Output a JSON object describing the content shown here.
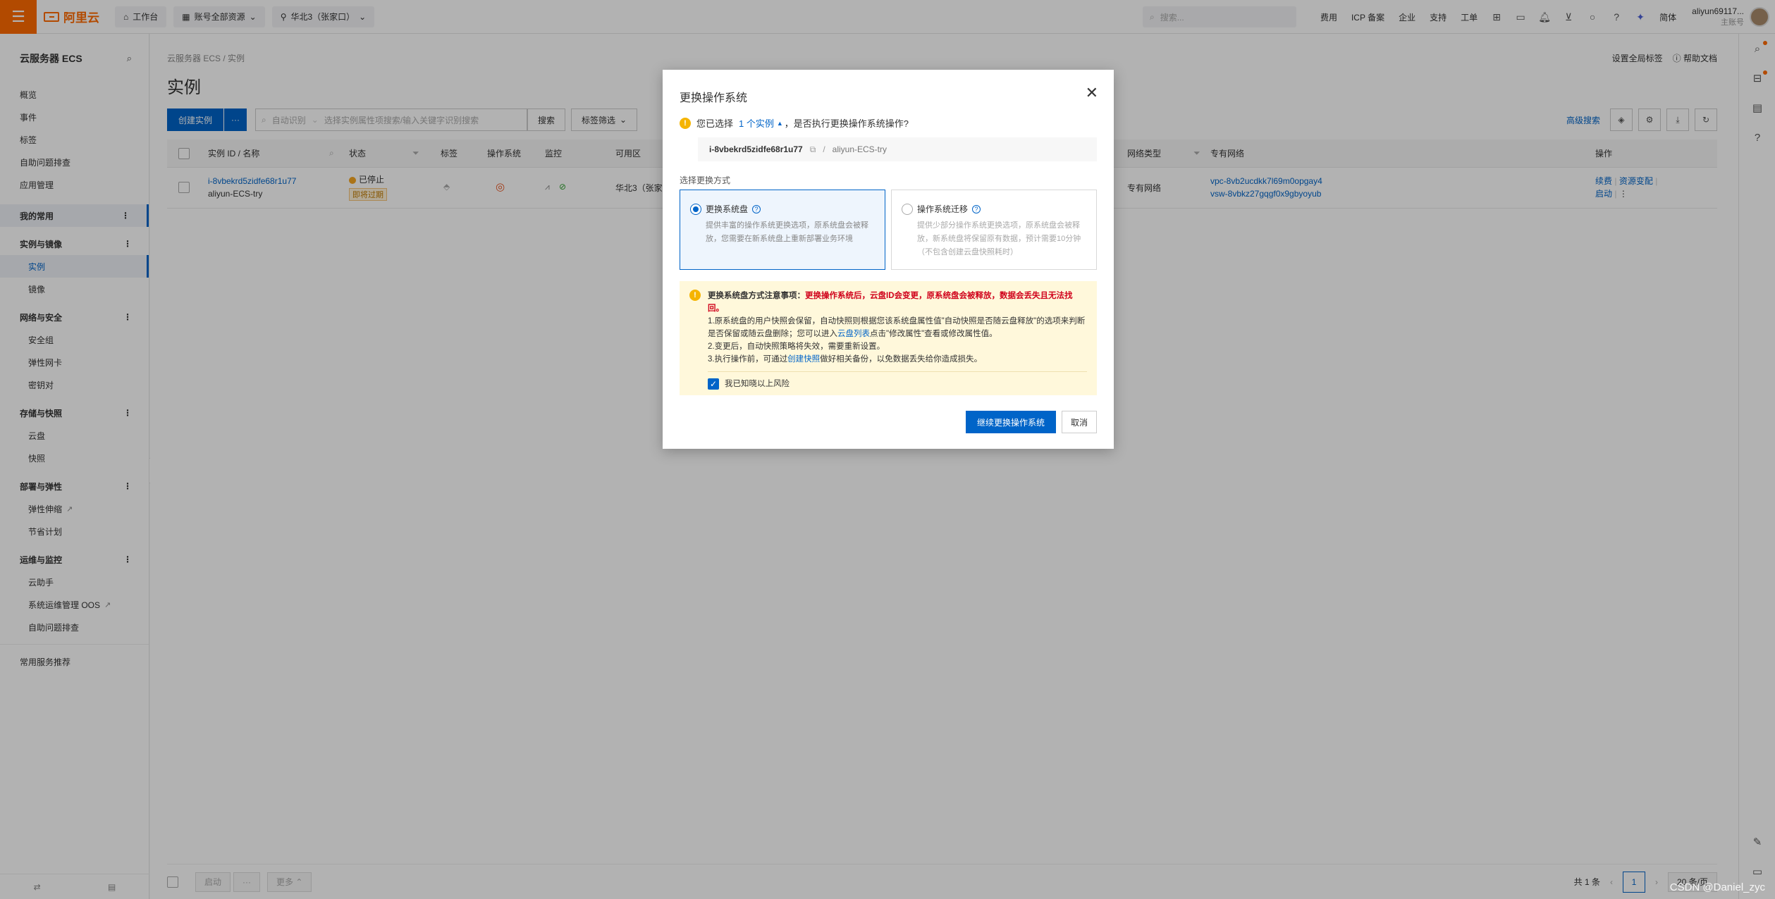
{
  "topbar": {
    "logo": "阿里云",
    "workbench": "工作台",
    "account_resources": "账号全部资源",
    "region": "华北3（张家口）",
    "search_placeholder": "搜索...",
    "links": [
      "费用",
      "ICP 备案",
      "企业",
      "支持",
      "工单"
    ],
    "lang": "简体",
    "user_name": "aliyun69117...",
    "user_role": "主账号"
  },
  "sidebar": {
    "title": "云服务器 ECS",
    "top_items": [
      "概览",
      "事件",
      "标签",
      "自助问题排查",
      "应用管理"
    ],
    "favorites": "我的常用",
    "groups": [
      {
        "label": "实例与镜像",
        "items": [
          "实例",
          "镜像"
        ]
      },
      {
        "label": "网络与安全",
        "items": [
          "安全组",
          "弹性网卡",
          "密钥对"
        ]
      },
      {
        "label": "存储与快照",
        "items": [
          "云盘",
          "快照"
        ]
      },
      {
        "label": "部署与弹性",
        "items": [
          "弹性伸缩",
          "节省计划"
        ]
      },
      {
        "label": "运维与监控",
        "items": [
          "云助手",
          "系统运维管理 OOS",
          "自助问题排查"
        ]
      }
    ],
    "recommend": "常用服务推荐"
  },
  "main": {
    "breadcrumb": "云服务器 ECS  /  实例",
    "title": "实例",
    "top_links": [
      "设置全局标签",
      "帮助文档"
    ],
    "create_button": "创建实例",
    "filter_mode": "自动识别",
    "filter_placeholder": "选择实例属性项搜索/输入关键字识别搜索",
    "search_button": "搜索",
    "tag_filter": "标签筛选",
    "advanced_search": "高级搜索",
    "columns": {
      "id_name": "实例 ID / 名称",
      "status": "状态",
      "tags": "标签",
      "os": "操作系统",
      "monitor": "监控",
      "zone": "可用区",
      "network_type": "网络类型",
      "vpc": "专有网络",
      "actions": "操作"
    },
    "row": {
      "id": "i-8vbekrd5zidfe68r1u77",
      "name": "aliyun-ECS-try",
      "status": "已停止",
      "overdue": "即将过期",
      "zone": "华北3（张家",
      "network_type": "专有网络",
      "vpc": "vpc-8vb2ucdkk7l69m0opgay4",
      "vsw": "vsw-8vbkz27gqgf0x9gbyoyub",
      "action1": "续费",
      "action2": "资源变配",
      "action3": "启动"
    },
    "footer": {
      "start": "启动",
      "more": "更多",
      "total": "共 1 条",
      "page": "1",
      "page_size": "20 条/页"
    }
  },
  "modal": {
    "title": "更换操作系统",
    "question_pre": "您已选择",
    "question_link": "1 个实例",
    "question_post": "，是否执行更换操作系统操作?",
    "instance_id": "i-8vbekrd5zidfe68r1u77",
    "instance_name": "aliyun-ECS-try",
    "section_label": "选择更换方式",
    "option1_title": "更换系统盘",
    "option1_desc": "提供丰富的操作系统更换选项，原系统盘会被释放，您需要在新系统盘上重新部署业务环境",
    "option2_title": "操作系统迁移",
    "option2_desc": "提供少部分操作系统更换选项，原系统盘会被释放，新系统盘将保留原有数据，预计需要10分钟（不包含创建云盘快照耗时）",
    "notice_title": "更换系统盘方式注意事项：",
    "notice_red": "更换操作系统后，云盘ID会变更，原系统盘会被释放，数据会丢失且无法找回。",
    "notice_1a": "1.原系统盘的用户快照会保留，自动快照则根据您该系统盘属性值\"自动快照是否随云盘释放\"的选项来判断是否保留或随云盘删除；您可以进入",
    "notice_1_link": "云盘列表",
    "notice_1b": "点击\"修改属性\"查看或修改属性值。",
    "notice_2": "2.变更后，自动快照策略将失效，需要重新设置。",
    "notice_3a": "3.执行操作前，可通过",
    "notice_3_link": "创建快照",
    "notice_3b": "做好相关备份，以免数据丢失给你造成损失。",
    "ack_label": "我已知晓以上风险",
    "continue_button": "继续更换操作系统",
    "cancel_button": "取消"
  },
  "watermark": "CSDN @Daniel_zyc"
}
